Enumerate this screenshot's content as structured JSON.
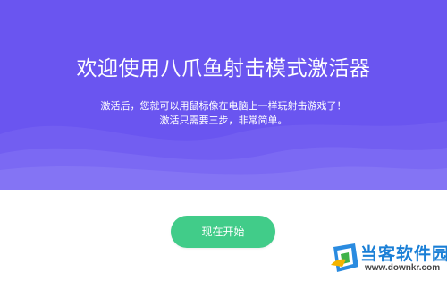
{
  "hero": {
    "title": "欢迎使用八爪鱼射击模式激活器",
    "subtitle_line1": "激活后，您就可以用鼠标像在电脑上一样玩射击游戏了！",
    "subtitle_line2": "激活只需要三步，非常简单。"
  },
  "actions": {
    "start_label": "现在开始"
  },
  "watermark": {
    "site_name": "当客软件园",
    "site_url": "www.downkr.com"
  },
  "colors": {
    "hero_bg": "#6a55f0",
    "button_bg": "#41cc89",
    "watermark_blue": "#1a7fd6"
  }
}
